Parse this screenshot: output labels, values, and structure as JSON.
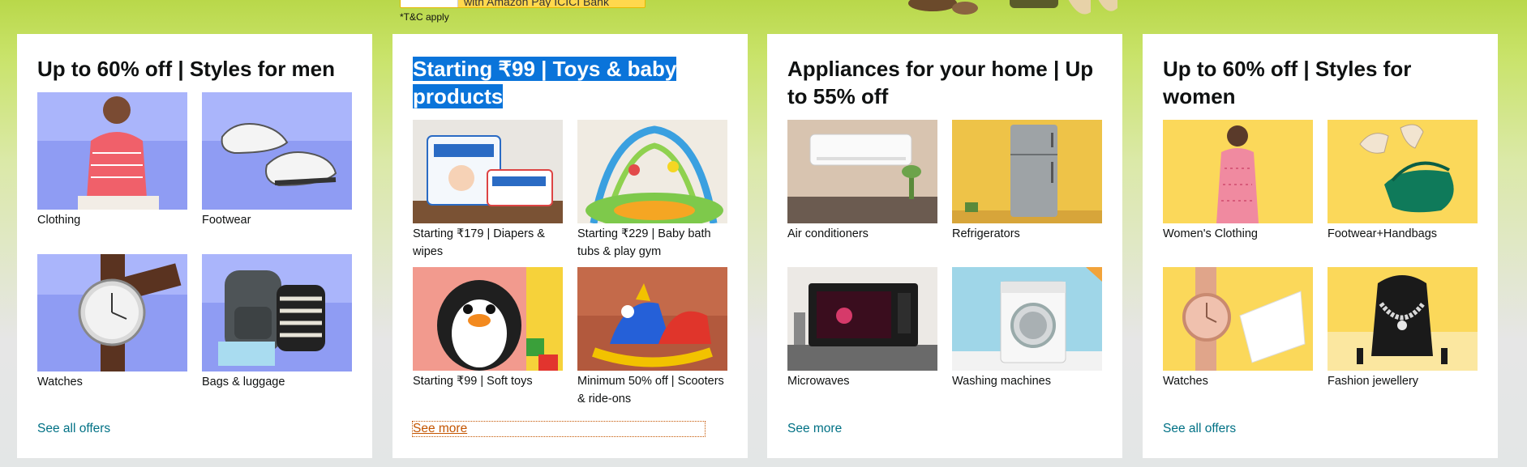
{
  "banner": {
    "promo_text": "with Amazon Pay ICICI Bank",
    "tc_text": "*T&C apply"
  },
  "cards": [
    {
      "title": "Up to 60% off | Styles for men",
      "link": "See all offers",
      "tiles": [
        {
          "label": "Clothing",
          "icon": "person-icon"
        },
        {
          "label": "Footwear",
          "icon": "sneakers-icon"
        },
        {
          "label": "Watches",
          "icon": "watch-icon"
        },
        {
          "label": "Bags & luggage",
          "icon": "backpack-icon"
        }
      ]
    },
    {
      "title": "Starting ₹99 | Toys & baby products",
      "link": "See more",
      "tiles": [
        {
          "label": "Starting ₹179 | Diapers & wipes",
          "icon": "diapers-icon"
        },
        {
          "label": "Starting ₹229 | Baby bath tubs & play gym",
          "icon": "play-gym-icon"
        },
        {
          "label": "Starting ₹99 | Soft toys",
          "icon": "penguin-toy-icon"
        },
        {
          "label": "Minimum 50% off | Scooters & ride-ons",
          "icon": "ride-on-toy-icon"
        }
      ]
    },
    {
      "title": "Appliances for your home | Up to 55% off",
      "link": "See more",
      "tiles": [
        {
          "label": "Air conditioners",
          "icon": "air-conditioner-icon"
        },
        {
          "label": "Refrigerators",
          "icon": "refrigerator-icon"
        },
        {
          "label": "Microwaves",
          "icon": "microwave-icon"
        },
        {
          "label": "Washing machines",
          "icon": "washing-machine-icon"
        }
      ]
    },
    {
      "title": "Up to 60% off | Styles for women",
      "link": "See all offers",
      "tiles": [
        {
          "label": "Women's Clothing",
          "icon": "dress-icon"
        },
        {
          "label": "Footwear+Handbags",
          "icon": "handbag-icon"
        },
        {
          "label": "Watches",
          "icon": "watch-icon"
        },
        {
          "label": "Fashion jewellery",
          "icon": "necklace-icon"
        }
      ]
    }
  ],
  "colors": {
    "link": "#007185",
    "link_focus": "#c45500",
    "selection": "#0a74da",
    "men_tile_bg": "#9aa6f5",
    "women_tile_bg": "#fbd85a"
  }
}
